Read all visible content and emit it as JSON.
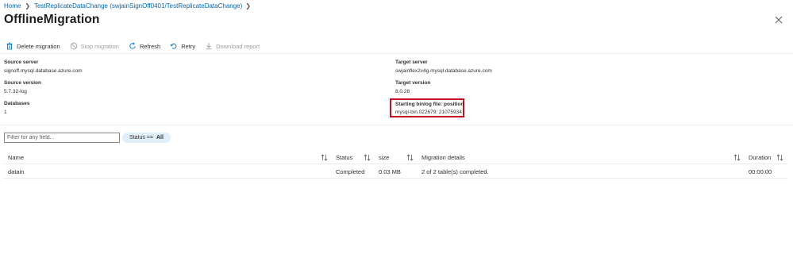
{
  "breadcrumb": {
    "home": "Home",
    "path": "TestReplicateDataChange (swjainSignOff0401/TestReplicateDataChange)"
  },
  "page_title": "OfflineMigration",
  "more_label": "···",
  "toolbar": {
    "delete_label": "Delete migration",
    "stop_label": "Stop migration",
    "refresh_label": "Refresh",
    "retry_label": "Retry",
    "download_label": "Download report"
  },
  "details": {
    "source_server_label": "Source server",
    "source_server_value": "signoff.mysql.database.azure.com",
    "source_version_label": "Source version",
    "source_version_value": "5.7.32-log",
    "databases_label": "Databases",
    "databases_value": "1",
    "target_server_label": "Target server",
    "target_server_value": "swjainflex2v4g.mysql.database.azure.com",
    "target_version_label": "Target version",
    "target_version_value": "8.0.28",
    "binlog_label": "Starting binlog file: position",
    "binlog_value": "mysql-bin.022679: 21075934"
  },
  "filter": {
    "placeholder": "Filter for any field...",
    "status_key": "Status ==",
    "status_value": "All"
  },
  "table": {
    "headers": {
      "name": "Name",
      "status": "Status",
      "size": "size",
      "migration_details": "Migration details",
      "duration": "Duration"
    },
    "rows": [
      {
        "name": "datain",
        "status": "Completed",
        "size": "0.03 MB",
        "migration_details": "2 of 2 table(s) completed.",
        "duration": "00:00:00"
      }
    ]
  },
  "colors": {
    "link": "#0067b8",
    "highlight_border": "#c50f1f",
    "pill_bg": "#e1effa",
    "divider": "#edebe9"
  },
  "icons": [
    "chevron-right-icon",
    "close-icon",
    "trash-icon",
    "stop-icon",
    "refresh-icon",
    "retry-icon",
    "download-icon",
    "sort-icon"
  ]
}
